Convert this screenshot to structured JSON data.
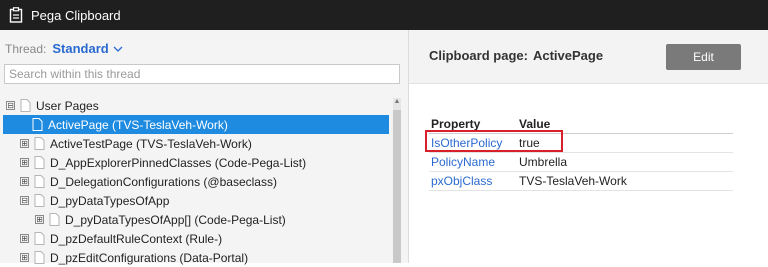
{
  "titlebar": {
    "title": "Pega Clipboard",
    "icon": "clipboard-icon"
  },
  "left": {
    "thread_label": "Thread:",
    "thread_value": "Standard",
    "search_placeholder": "Search within this thread",
    "tree": [
      {
        "label": "User Pages",
        "expander": "⊟",
        "level": 0
      },
      {
        "label": "ActivePage (TVS-TeslaVeh-Work)",
        "expander": "",
        "level": 1,
        "selected": true
      },
      {
        "label": "ActiveTestPage (TVS-TeslaVeh-Work)",
        "expander": "⊞",
        "level": 1
      },
      {
        "label": "D_AppExplorerPinnedClasses (Code-Pega-List)",
        "expander": "⊞",
        "level": 1
      },
      {
        "label": "D_DelegationConfigurations (@baseclass)",
        "expander": "⊞",
        "level": 1
      },
      {
        "label": "D_pyDataTypesOfApp",
        "expander": "⊟",
        "level": 1
      },
      {
        "label": "D_pyDataTypesOfApp[] (Code-Pega-List)",
        "expander": "⊞",
        "level": 2
      },
      {
        "label": "D_pzDefaultRuleContext (Rule-)",
        "expander": "⊞",
        "level": 1
      },
      {
        "label": "D_pzEditConfigurations (Data-Portal)",
        "expander": "⊞",
        "level": 1
      }
    ]
  },
  "right": {
    "clipboard_page_label": "Clipboard page:",
    "clipboard_page_value": "ActivePage",
    "edit_label": "Edit",
    "columns": [
      "Property",
      "Value"
    ],
    "rows": [
      {
        "property": "IsOtherPolicy",
        "value": "true"
      },
      {
        "property": "PolicyName",
        "value": "Umbrella"
      },
      {
        "property": "pxObjClass",
        "value": "TVS-TeslaVeh-Work"
      }
    ]
  },
  "colors": {
    "selected": "#1e8be0",
    "link": "#2a6ad0",
    "highlight": "#d8202b",
    "titlebar": "#1f1f1f"
  }
}
